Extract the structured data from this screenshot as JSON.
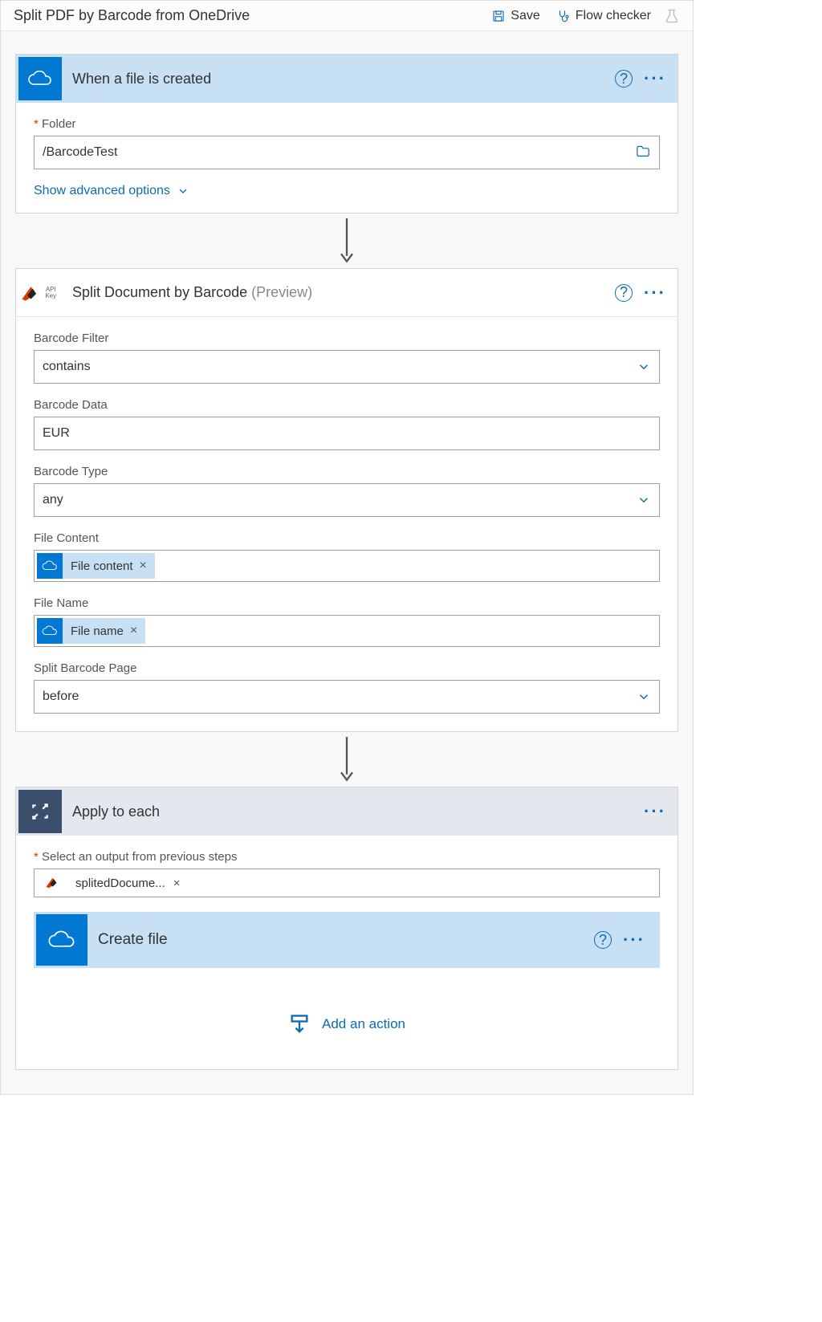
{
  "header": {
    "title": "Split PDF by Barcode from OneDrive",
    "save_label": "Save",
    "flow_checker_label": "Flow checker"
  },
  "trigger": {
    "title": "When a file is created",
    "folder_label": "Folder",
    "folder_value": "/BarcodeTest",
    "advanced_link": "Show advanced options"
  },
  "action1": {
    "title": "Split Document by Barcode",
    "preview": "(Preview)",
    "fields": {
      "barcode_filter_label": "Barcode Filter",
      "barcode_filter_value": "contains",
      "barcode_data_label": "Barcode Data",
      "barcode_data_value": "EUR",
      "barcode_type_label": "Barcode Type",
      "barcode_type_value": "any",
      "file_content_label": "File Content",
      "file_content_token": "File content",
      "file_name_label": "File Name",
      "file_name_token": "File name",
      "split_page_label": "Split Barcode Page",
      "split_page_value": "before"
    }
  },
  "foreach": {
    "title": "Apply to each",
    "select_label": "Select an output from previous steps",
    "select_token": "splitedDocume...",
    "inner_action_title": "Create file",
    "add_action_label": "Add an action"
  },
  "icons": {
    "api_key_text": "API Key"
  }
}
